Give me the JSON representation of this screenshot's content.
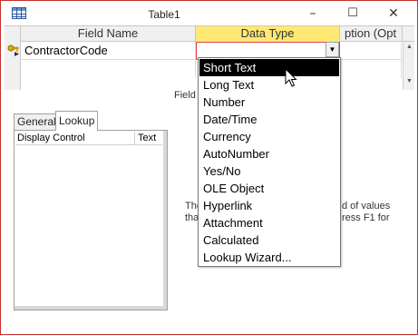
{
  "window": {
    "title": "Table1",
    "controls": {
      "minimize": "–",
      "maximize": "☐",
      "close": "✕"
    }
  },
  "grid": {
    "columns": [
      "Field Name",
      "Data Type",
      "ption (Opt"
    ],
    "rows": [
      {
        "field_name": "ContractorCode",
        "data_type": "",
        "primary_key": true
      }
    ]
  },
  "field_properties_label": "Field",
  "properties": {
    "tabs": [
      "General",
      "Lookup"
    ],
    "active_tab": "Lookup",
    "rows": [
      {
        "name": "Display Control",
        "value": "Text"
      }
    ]
  },
  "help_fragments": {
    "line1_left": "The",
    "line1_right": "d of values",
    "line2_left": "tha",
    "line2_right": "ress F1 for"
  },
  "data_type_dropdown": {
    "selected": "Short Text",
    "options": [
      "Short Text",
      "Long Text",
      "Number",
      "Date/Time",
      "Currency",
      "AutoNumber",
      "Yes/No",
      "OLE Object",
      "Hyperlink",
      "Attachment",
      "Calculated",
      "Lookup Wizard..."
    ]
  },
  "colors": {
    "selected_option_bg": "#000000",
    "active_header": "#ffe873",
    "window_border": "#c4312b"
  }
}
